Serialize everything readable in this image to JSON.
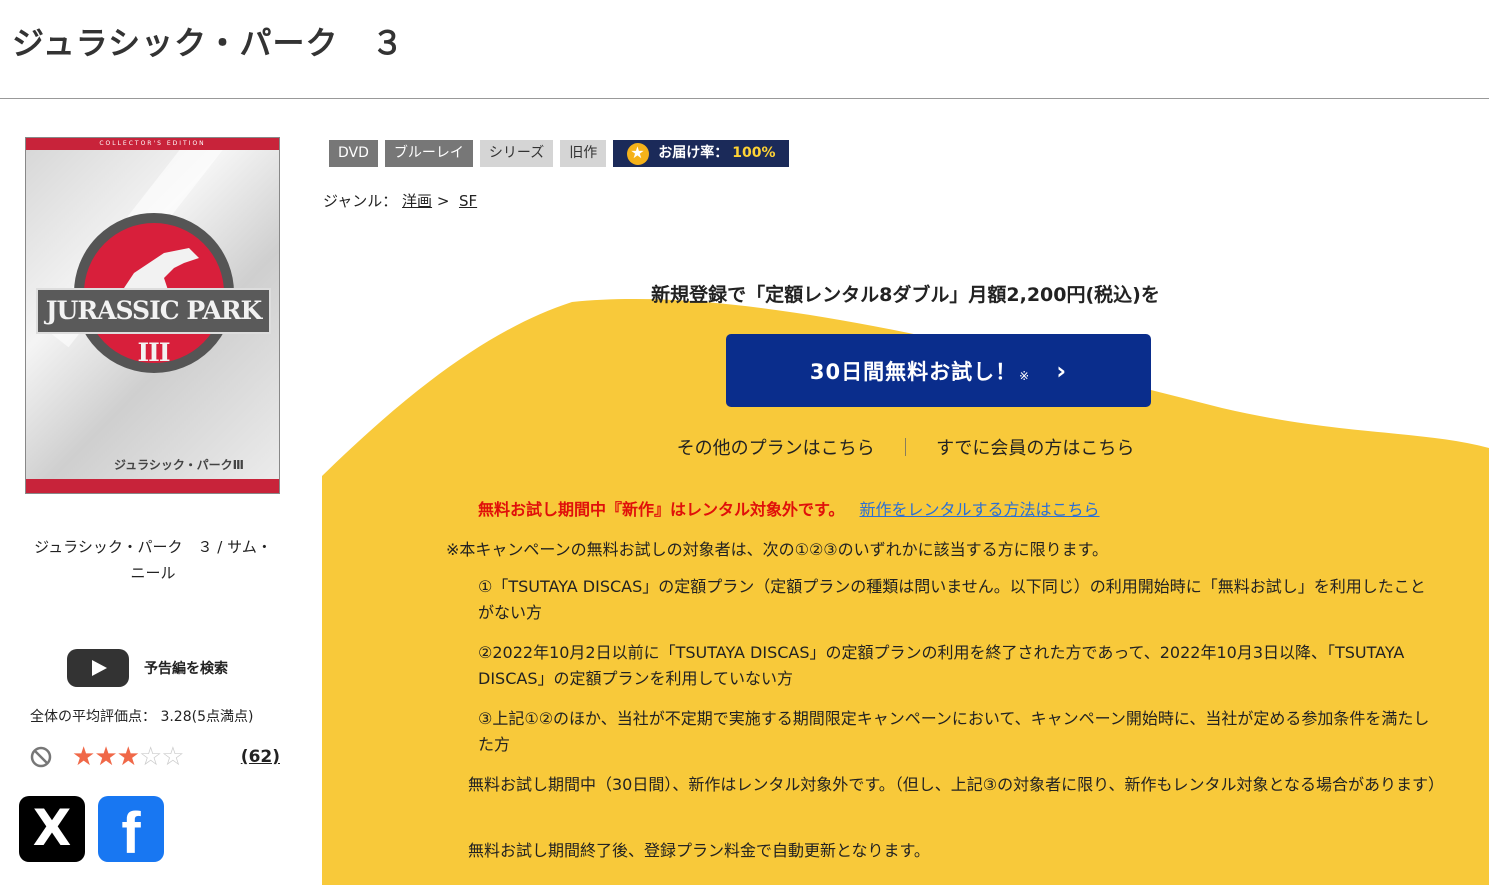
{
  "header": {
    "title": "ジュラシック・パーク　３"
  },
  "poster": {
    "top_text": "COLLECTOR'S EDITION",
    "logo_text": "JURASSIC PARK III",
    "bottom_text": "ジュラシック・パークⅢ"
  },
  "product": {
    "caption": "ジュラシック・パーク　３ / サム・ニール"
  },
  "trailer": {
    "label": "予告編を検索"
  },
  "rating": {
    "text": "全体の平均評価点： 3.28(5点満点)",
    "value": 3.28,
    "max": 5,
    "count_label": "(62)"
  },
  "badges": {
    "dvd": "DVD",
    "bluray": "ブルーレイ",
    "series": "シリーズ",
    "old": "旧作",
    "delivery_label": "お届け率：",
    "delivery_pct": "100%"
  },
  "genre": {
    "label": "ジャンル：",
    "cat1": "洋画",
    "sep": ">",
    "cat2": "SF"
  },
  "promo": {
    "headline": "新規登録で「定額レンタル8ダブル」月額2,200円(税込)を",
    "cta_label": "30日間無料お試し！",
    "cta_note": "※",
    "other_plans": "その他のプランはこちら",
    "separator": "｜",
    "member_link": "すでに会員の方はこちら",
    "warning": "無料お試し期間中『新作』はレンタル対象外です。",
    "warning_link": "新作をレンタルする方法はこちら",
    "conditions_intro": "※本キャンペーンの無料お試しの対象者は、次の①②③のいずれかに該当する方に限ります。",
    "conditions": [
      "①「TSUTAYA DISCAS」の定額プラン（定額プランの種類は問いません。以下同じ）の利用開始時に「無料お試し」を利用したことがない方",
      "②2022年10月2日以前に「TSUTAYA DISCAS」の定額プランの利用を終了された方であって、2022年10月3日以降、「TSUTAYA DISCAS」の定額プランを利用していない方",
      "③上記①②のほか、当社が不定期で実施する期間限定キャンペーンにおいて、キャンペーン開始時に、当社が定める参加条件を満たした方"
    ],
    "note_new": "無料お試し期間中（30日間）、新作はレンタル対象外です。（但し、上記③の対象者に限り、新作もレンタル対象となる場合があります）",
    "note_renew": "無料お試し期間終了後、登録プラン料金で自動更新となります。"
  },
  "social": {
    "x": "X",
    "facebook": "f"
  },
  "colors": {
    "promo_yellow": "#f8c93a",
    "cta_blue": "#0a2d8c",
    "warning_red": "#e0100a",
    "link_blue": "#2a6fd6",
    "star_orange": "#f06848"
  }
}
